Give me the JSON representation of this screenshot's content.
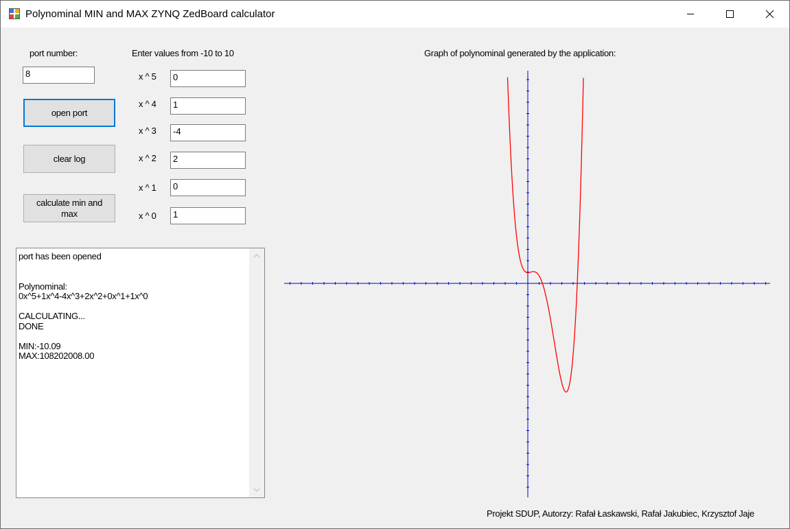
{
  "window": {
    "title": "Polynominal MIN and MAX ZYNQ ZedBoard calculator"
  },
  "port": {
    "label": "port number:",
    "value": "8"
  },
  "buttons": {
    "open_port": "open port",
    "clear_log": "clear log",
    "calculate": "calculate min and max"
  },
  "coefficients": {
    "header": "Enter values from -10 to 10",
    "items": [
      {
        "label": "x ^ 5",
        "value": "0"
      },
      {
        "label": "x ^ 4",
        "value": "1"
      },
      {
        "label": "x ^ 3",
        "value": "-4"
      },
      {
        "label": "x ^ 2",
        "value": "2"
      },
      {
        "label": "x ^ 1",
        "value": "0"
      },
      {
        "label": "x ^ 0",
        "value": "1"
      }
    ]
  },
  "log": {
    "text": "port has been opened\n\n\nPolynominal:\n0x^5+1x^4-4x^3+2x^2+0x^1+1x^0\n\nCALCULATING...\nDONE\n\nMIN:-10.09\nMAX:108202008.00"
  },
  "graph": {
    "title": "Graph of polynominal generated by the application:",
    "axis_color": "#0000cc",
    "curve_color": "#ff0000"
  },
  "footer": {
    "text": "Projekt SDUP, Autorzy: Rafał Łaskawski, Rafał Jakubiec, Krzysztof Jaje"
  }
}
